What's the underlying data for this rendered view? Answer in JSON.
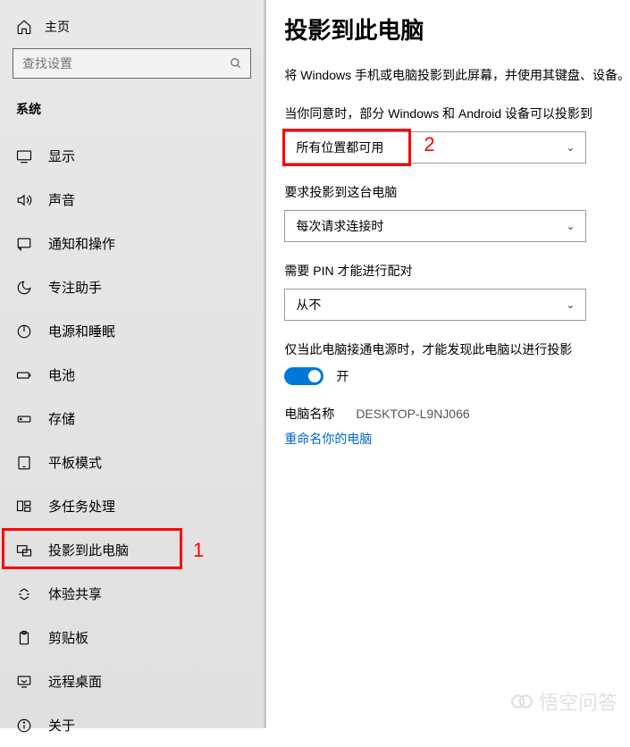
{
  "sidebar": {
    "home": "主页",
    "search_placeholder": "查找设置",
    "section_header": "系统",
    "items": [
      {
        "icon": "display",
        "label": "显示"
      },
      {
        "icon": "sound",
        "label": "声音"
      },
      {
        "icon": "notify",
        "label": "通知和操作"
      },
      {
        "icon": "focus",
        "label": "专注助手"
      },
      {
        "icon": "power",
        "label": "电源和睡眠"
      },
      {
        "icon": "battery",
        "label": "电池"
      },
      {
        "icon": "storage",
        "label": "存储"
      },
      {
        "icon": "tablet",
        "label": "平板模式"
      },
      {
        "icon": "multi",
        "label": "多任务处理"
      },
      {
        "icon": "project",
        "label": "投影到此电脑"
      },
      {
        "icon": "shared",
        "label": "体验共享"
      },
      {
        "icon": "clip",
        "label": "剪贴板"
      },
      {
        "icon": "remote",
        "label": "远程桌面"
      },
      {
        "icon": "about",
        "label": "关于"
      }
    ]
  },
  "main": {
    "title": "投影到此电脑",
    "description": "将 Windows 手机或电脑投影到此屏幕，并使用其键盘、设备。",
    "setting_availability": {
      "label": "当你同意时，部分 Windows 和 Android 设备可以投影到",
      "value": "所有位置都可用"
    },
    "setting_ask": {
      "label": "要求投影到这台电脑",
      "value": "每次请求连接时"
    },
    "setting_pin": {
      "label": "需要 PIN 才能进行配对",
      "value": "从不"
    },
    "setting_power": {
      "label": "仅当此电脑接通电源时，才能发现此电脑以进行投影",
      "toggle_state": "开"
    },
    "pc_name_label": "电脑名称",
    "pc_name_value": "DESKTOP-L9NJ066",
    "rename_link": "重命名你的电脑"
  },
  "annotations": {
    "n1": "1",
    "n2": "2"
  },
  "watermark": "悟空问答"
}
